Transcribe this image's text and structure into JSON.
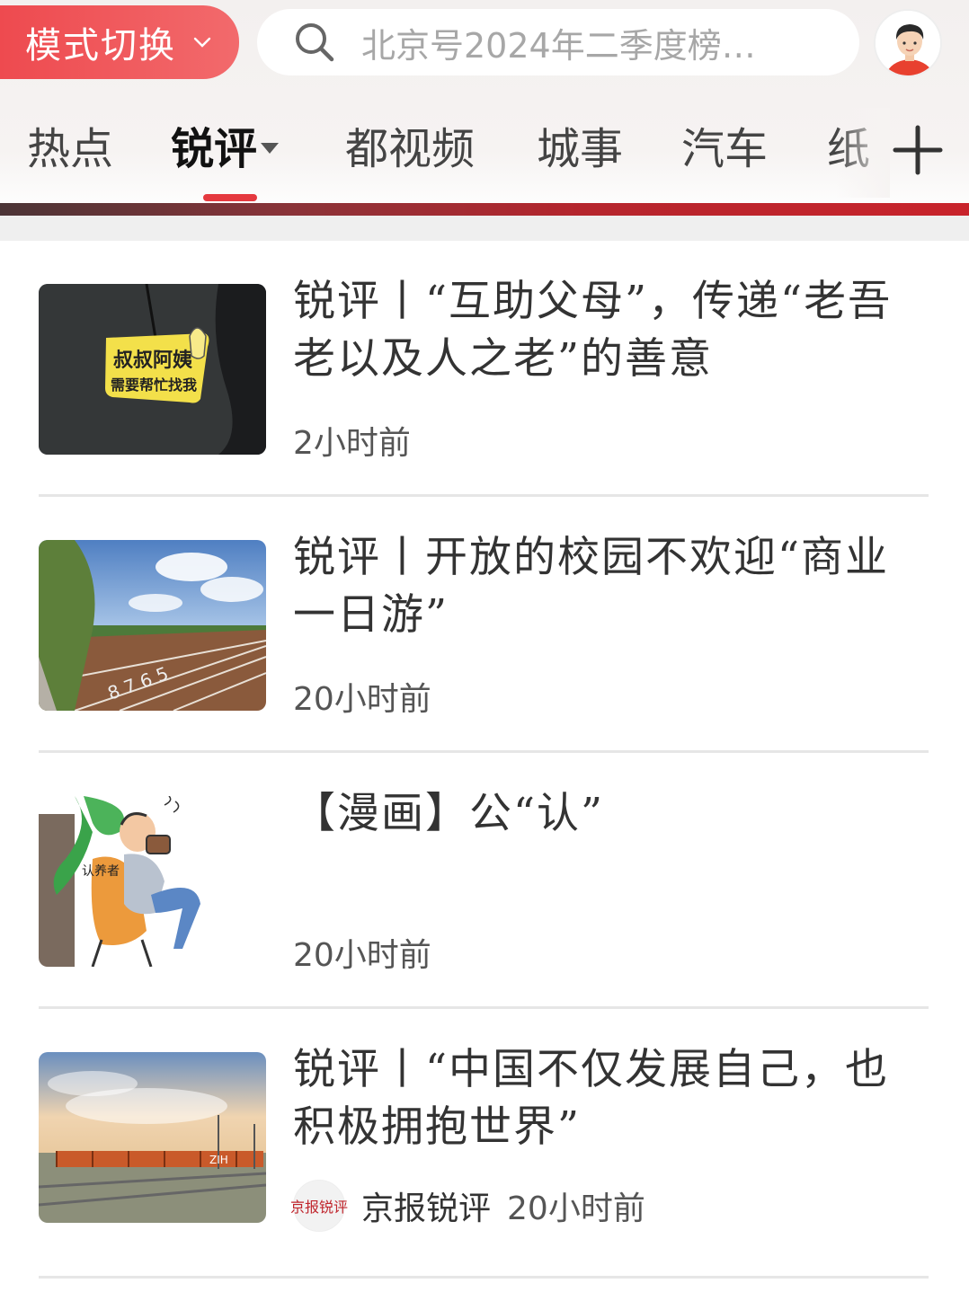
{
  "header": {
    "mode_switch_label": "模式切换",
    "search_text": "北京号2024年二季度榜…",
    "tabs": [
      {
        "label": "热点"
      },
      {
        "label": "锐评"
      },
      {
        "label": "都视频"
      },
      {
        "label": "城事"
      },
      {
        "label": "汽车"
      },
      {
        "label": "纸"
      }
    ]
  },
  "colors": {
    "accent": "#e5393f",
    "mode_switch_bg": "#ee4a4f",
    "title_text": "#333333",
    "meta_text": "#555555"
  },
  "feed": {
    "items": [
      {
        "title": "锐评丨“互助父母”，传递“老吾老以及人之老”的善意",
        "time": "2小时前",
        "thumb_text_line1": "叔叔阿姨",
        "thumb_text_line2": "需要帮忙找我"
      },
      {
        "title": "锐评丨开放的校园不欢迎“商业一日游”",
        "time": "20小时前"
      },
      {
        "title": "【漫画】公“认”",
        "time": "20小时前",
        "thumb_text": "认养者"
      },
      {
        "title": "锐评丨“中国不仅发展自己，也积极拥抱世界”",
        "source": "京报锐评",
        "source_logo_text": "京报锐评",
        "time": "20小时前",
        "thumb_text": "ZIH"
      }
    ]
  }
}
